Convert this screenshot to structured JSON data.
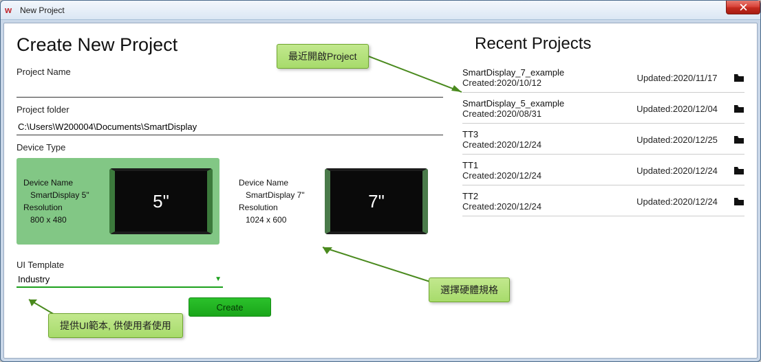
{
  "window": {
    "title": "New Project"
  },
  "left": {
    "page_title": "Create New Project",
    "project_name_label": "Project Name",
    "project_name_value": "",
    "project_folder_label": "Project folder",
    "project_folder_value": "C:\\Users\\W200004\\Documents\\SmartDisplay",
    "device_type_label": "Device Type",
    "devices": [
      {
        "name_label": "Device Name",
        "name": "SmartDisplay 5\"",
        "res_label": "Resolution",
        "res": "800 x 480",
        "badge": "5\"",
        "selected": true
      },
      {
        "name_label": "Device Name",
        "name": "SmartDisplay 7\"",
        "res_label": "Resolution",
        "res": "1024 x 600",
        "badge": "7\"",
        "selected": false
      }
    ],
    "ui_template_label": "UI Template",
    "ui_template_value": "Industry",
    "create_label": "Create"
  },
  "right": {
    "title": "Recent Projects",
    "items": [
      {
        "name": "SmartDisplay_7_example",
        "created": "Created:2020/10/12",
        "updated": "Updated:2020/11/17"
      },
      {
        "name": "SmartDisplay_5_example",
        "created": "Created:2020/08/31",
        "updated": "Updated:2020/12/04"
      },
      {
        "name": "TT3",
        "created": "Created:2020/12/24",
        "updated": "Updated:2020/12/25"
      },
      {
        "name": "TT1",
        "created": "Created:2020/12/24",
        "updated": "Updated:2020/12/24"
      },
      {
        "name": "TT2",
        "created": "Created:2020/12/24",
        "updated": "Updated:2020/12/24"
      }
    ]
  },
  "callouts": {
    "recent": "最近開啟Project",
    "device": "選擇硬體規格",
    "template": "提供UI範本, 供使用者使用"
  }
}
